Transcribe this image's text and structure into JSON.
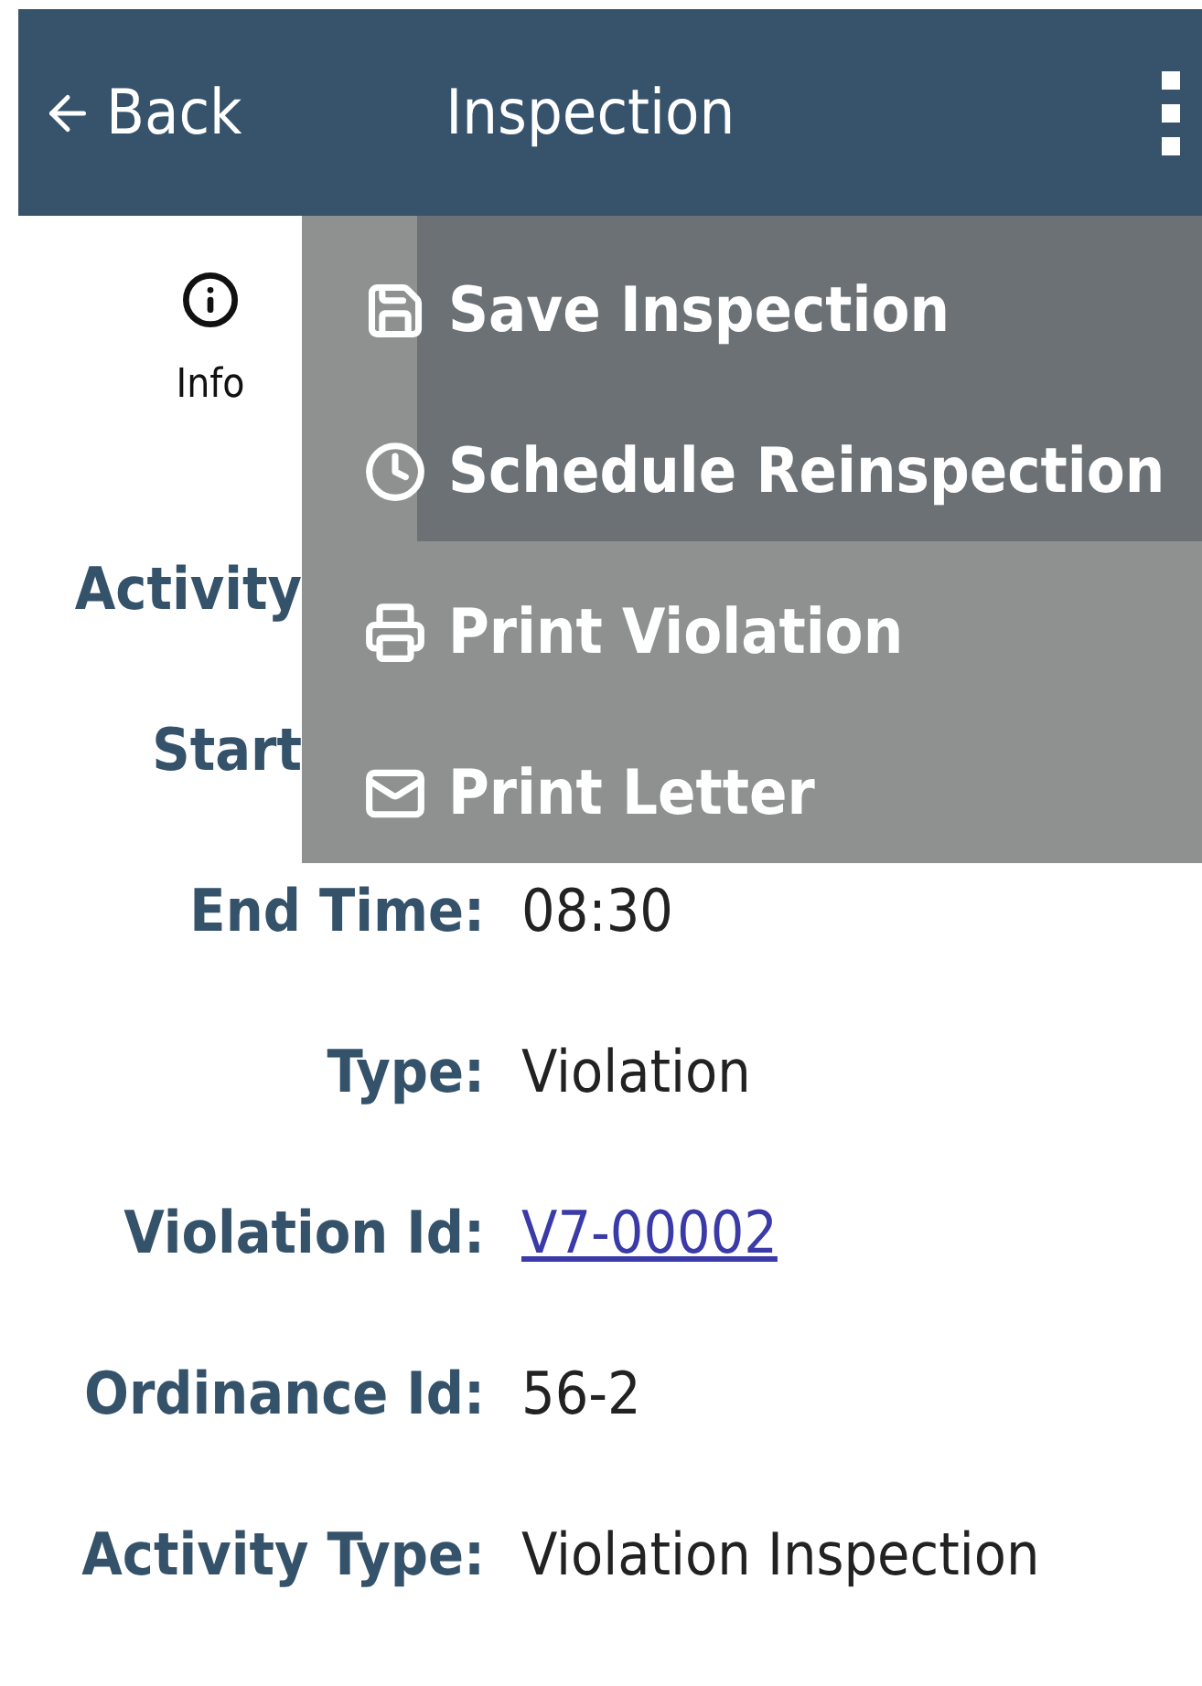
{
  "header": {
    "back": "Back",
    "title": "Inspection"
  },
  "tabs": [
    {
      "label": "Info",
      "selected": true
    }
  ],
  "menu": {
    "items": [
      {
        "label": "Save Inspection"
      },
      {
        "label": "Schedule Reinspection"
      },
      {
        "label": "Print Violation"
      },
      {
        "label": "Print Letter"
      }
    ]
  },
  "fields": [
    {
      "label": "Activity",
      "kind": "covered"
    },
    {
      "label": "Start",
      "kind": "covered"
    },
    {
      "label": "End Time:",
      "value": "08:30",
      "kind": "text"
    },
    {
      "label": "Type:",
      "value": "Violation",
      "kind": "text"
    },
    {
      "label": "Violation Id:",
      "value": "V7-00002",
      "kind": "link"
    },
    {
      "label": "Ordinance Id:",
      "value": "56-2",
      "kind": "text"
    },
    {
      "label": "Activity Type:",
      "value": "Violation Inspection",
      "kind": "text"
    }
  ]
}
